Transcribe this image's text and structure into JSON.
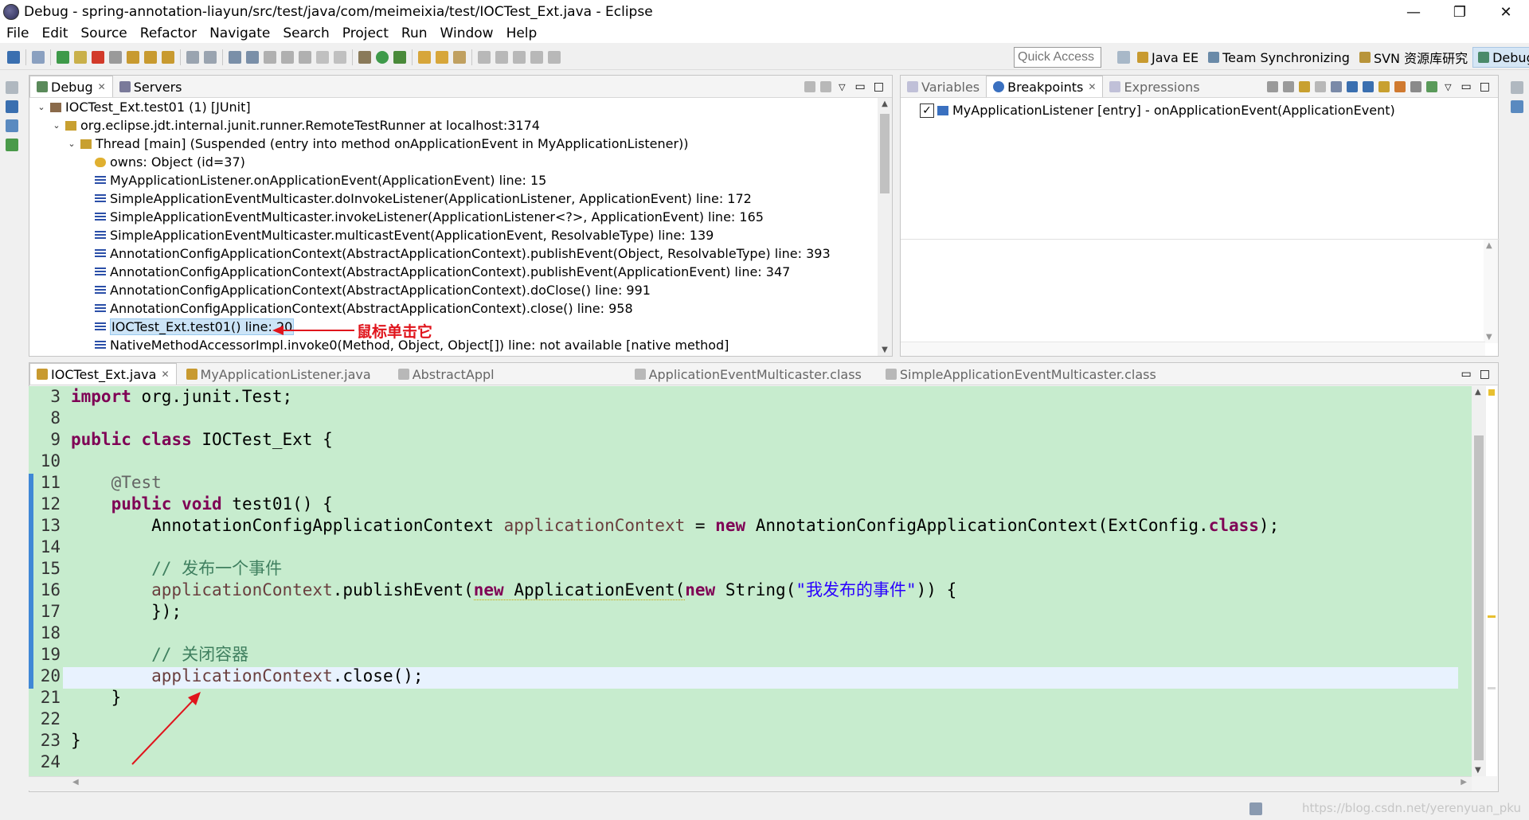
{
  "window": {
    "title": "Debug - spring-annotation-liayun/src/test/java/com/meimeixia/test/IOCTest_Ext.java - Eclipse",
    "minimize_glyph": "—",
    "maximize_glyph": "❐",
    "close_glyph": "✕"
  },
  "menu": [
    "File",
    "Edit",
    "Source",
    "Refactor",
    "Navigate",
    "Search",
    "Project",
    "Run",
    "Window",
    "Help"
  ],
  "toolbar": {
    "quick_access_placeholder": "Quick Access",
    "perspectives": [
      {
        "label": "Java EE",
        "active": false
      },
      {
        "label": "Team Synchronizing",
        "active": false
      },
      {
        "label": "SVN 资源库研究",
        "active": false
      },
      {
        "label": "Debug",
        "active": true
      }
    ]
  },
  "debug_view": {
    "tabs": [
      {
        "label": "Debug",
        "active": true,
        "closable": true
      },
      {
        "label": "Servers",
        "active": false,
        "closable": false
      }
    ],
    "tree": [
      {
        "text": "IOCTest_Ext.test01 (1) [JUnit]",
        "indent": 0,
        "twisty": "⌄",
        "icon": "junit-icon"
      },
      {
        "text": "org.eclipse.jdt.internal.junit.runner.RemoteTestRunner at localhost:3174",
        "indent": 1,
        "twisty": "⌄",
        "icon": "process-icon"
      },
      {
        "text": "Thread [main] (Suspended (entry into method onApplicationEvent in MyApplicationListener))",
        "indent": 2,
        "twisty": "⌄",
        "icon": "thread-icon"
      },
      {
        "text": "owns: Object  (id=37)",
        "indent": 3,
        "twisty": "",
        "icon": "monitor-icon"
      },
      {
        "text": "MyApplicationListener.onApplicationEvent(ApplicationEvent) line: 15",
        "indent": 3,
        "twisty": "",
        "icon": "stack-frame-icon"
      },
      {
        "text": "SimpleApplicationEventMulticaster.doInvokeListener(ApplicationListener, ApplicationEvent) line: 172",
        "indent": 3,
        "twisty": "",
        "icon": "stack-frame-icon"
      },
      {
        "text": "SimpleApplicationEventMulticaster.invokeListener(ApplicationListener<?>, ApplicationEvent) line: 165",
        "indent": 3,
        "twisty": "",
        "icon": "stack-frame-icon"
      },
      {
        "text": "SimpleApplicationEventMulticaster.multicastEvent(ApplicationEvent, ResolvableType) line: 139",
        "indent": 3,
        "twisty": "",
        "icon": "stack-frame-icon"
      },
      {
        "text": "AnnotationConfigApplicationContext(AbstractApplicationContext).publishEvent(Object, ResolvableType) line: 393",
        "indent": 3,
        "twisty": "",
        "icon": "stack-frame-icon"
      },
      {
        "text": "AnnotationConfigApplicationContext(AbstractApplicationContext).publishEvent(ApplicationEvent) line: 347",
        "indent": 3,
        "twisty": "",
        "icon": "stack-frame-icon"
      },
      {
        "text": "AnnotationConfigApplicationContext(AbstractApplicationContext).doClose() line: 991",
        "indent": 3,
        "twisty": "",
        "icon": "stack-frame-icon"
      },
      {
        "text": "AnnotationConfigApplicationContext(AbstractApplicationContext).close() line: 958",
        "indent": 3,
        "twisty": "",
        "icon": "stack-frame-icon"
      },
      {
        "text": "IOCTest_Ext.test01() line: 20",
        "indent": 3,
        "twisty": "",
        "icon": "stack-frame-icon",
        "selected": true
      },
      {
        "text": "NativeMethodAccessorImpl.invoke0(Method, Object, Object[]) line: not available [native method]",
        "indent": 3,
        "twisty": "",
        "icon": "stack-frame-icon"
      }
    ],
    "annotation": "鼠标单击它"
  },
  "breakpoints_view": {
    "tabs": [
      {
        "label": "Variables",
        "active": false
      },
      {
        "label": "Breakpoints",
        "active": true,
        "closable": true
      },
      {
        "label": "Expressions",
        "active": false
      }
    ],
    "items": [
      {
        "text": "MyApplicationListener [entry] - onApplicationEvent(ApplicationEvent)",
        "checked": true
      }
    ]
  },
  "editor": {
    "tabs": [
      {
        "label": "IOCTest_Ext.java",
        "active": true,
        "closable": true
      },
      {
        "label": "MyApplicationListener.java",
        "active": false
      },
      {
        "label": "AbstractAppl",
        "active": false
      },
      {
        "label": "ApplicationEventMulticaster.class",
        "active": false
      },
      {
        "label": "SimpleApplicationEventMulticaster.class",
        "active": false
      }
    ],
    "line_numbers": [
      "3",
      "8",
      "9",
      "10",
      "11",
      "12",
      "13",
      "14",
      "15",
      "16",
      "17",
      "18",
      "19",
      "20",
      "21",
      "22",
      "23",
      "24"
    ],
    "code": {
      "l3_kw": "import",
      "l3_rest": " org.junit.Test;",
      "l9_kw1": "public",
      "l9_kw2": "class",
      "l9_rest": " IOCTest_Ext {",
      "l11_ann": "    @Test",
      "l12_kw1": "    public",
      "l12_kw2": "void",
      "l12_rest": " test01() {",
      "l13_type": "        AnnotationConfigApplicationContext ",
      "l13_var": "applicationContext",
      "l13_eq": " = ",
      "l13_new": "new",
      "l13_ctor": " AnnotationConfigApplicationContext(ExtConfig.",
      "l13_class": "class",
      "l13_end": ");",
      "l15_cmt": "        // 发布一个事件",
      "l16_var": "        applicationContext",
      "l16_call": ".publishEvent(",
      "l16_new1": "new",
      "l16_type": " ApplicationEvent(",
      "l16_new2": "new",
      "l16_str_call": " String(",
      "l16_str": "\"我发布的事件\"",
      "l16_end": ")) {",
      "l17": "        });",
      "l19_cmt": "        // 关闭容器",
      "l20_var": "        applicationContext",
      "l20_rest": ".close();",
      "l21": "    }",
      "l23": "}"
    }
  },
  "statusbar": {
    "watermark": "https://blog.csdn.net/yerenyuan_pku"
  }
}
